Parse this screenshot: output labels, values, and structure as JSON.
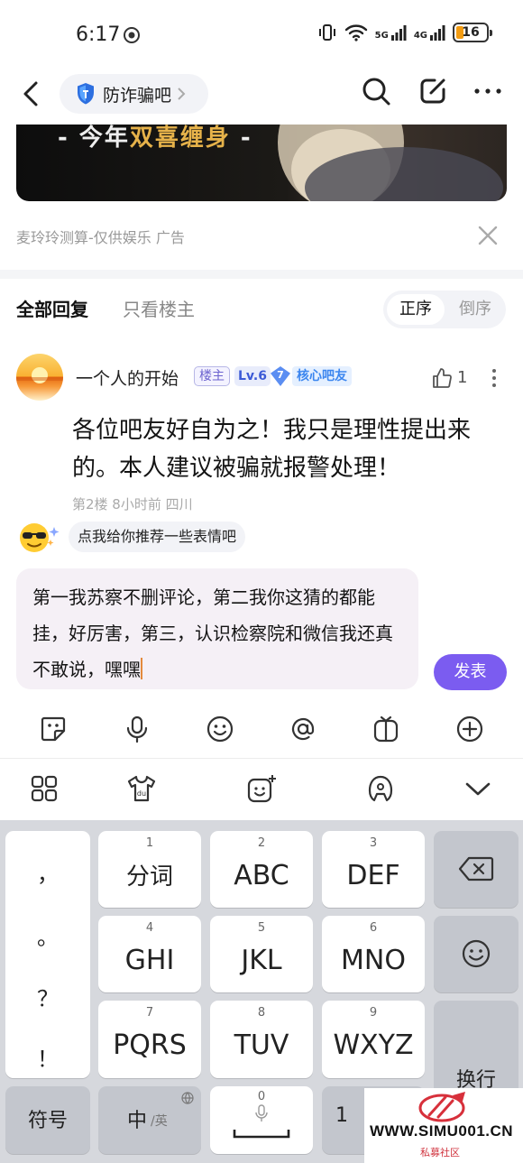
{
  "status_bar": {
    "time": "6:17",
    "net1": "5G",
    "net2": "4G",
    "battery": "16"
  },
  "nav": {
    "forum_name": "防诈骗吧"
  },
  "ad": {
    "banner_text_prefix": "- 今年",
    "banner_text_highlight": "双喜缠身",
    "banner_text_suffix": " -",
    "source": "麦玲玲测算-仅供娱乐  广告"
  },
  "tabs": {
    "all": "全部回复",
    "op_only": "只看楼主",
    "sort_asc": "正序",
    "sort_desc": "倒序"
  },
  "reply": {
    "username": "一个人的开始",
    "badge_op": "楼主",
    "badge_level": "Lv.6",
    "badge_core_num": "7",
    "badge_core": "核心吧友",
    "likes": "1",
    "text": "各位吧友好自为之！我只是理性提出来的。本人建议被骗就报警处理！",
    "meta": "第2楼  8小时前  四川"
  },
  "emoji_suggestion": "点我给你推荐一些表情吧",
  "input": {
    "value": "第一我苏察不删评论，第二我你这猜的都能挂，好厉害，第三，认识检察院和微信我还真不敢说，嘿嘿"
  },
  "send_label": "发表",
  "keyboard": {
    "punct": [
      "，",
      "。",
      "？",
      "！"
    ],
    "keys": [
      {
        "num": "1",
        "label": "分词"
      },
      {
        "num": "2",
        "label": "ABC"
      },
      {
        "num": "3",
        "label": "DEF"
      },
      {
        "num": "4",
        "label": "GHI"
      },
      {
        "num": "5",
        "label": "JKL"
      },
      {
        "num": "6",
        "label": "MNO"
      },
      {
        "num": "7",
        "label": "PQRS"
      },
      {
        "num": "8",
        "label": "TUV"
      },
      {
        "num": "9",
        "label": "WXYZ"
      }
    ],
    "symbol": "符号",
    "lang_main": "中",
    "lang_alt": "/英",
    "space_num": "0",
    "enter": "换行",
    "partial_key": "1"
  },
  "watermark": {
    "text": "WWW.SIMU001.CN",
    "sub": "私募社区"
  },
  "colors": {
    "accent": "#7b5cf0",
    "badge_blue": "#3c86ef"
  }
}
